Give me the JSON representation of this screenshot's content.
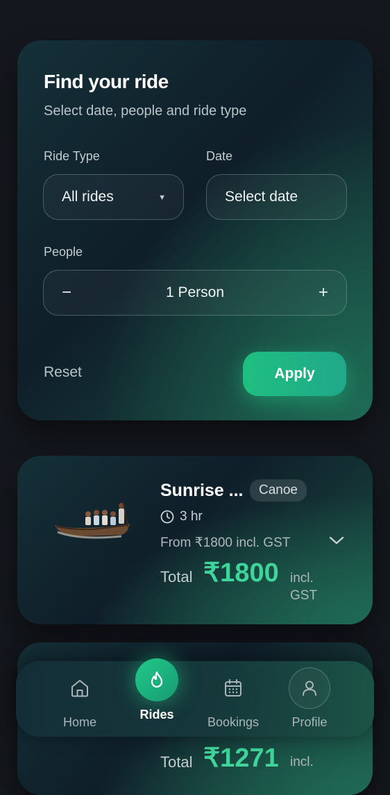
{
  "filter": {
    "title": "Find your ride",
    "subtitle": "Select date, people and ride type",
    "ride_type_label": "Ride Type",
    "ride_type_value": "All rides",
    "date_label": "Date",
    "date_placeholder": "Select date",
    "people_label": "People",
    "people_minus": "−",
    "people_value": "1 Person",
    "people_plus": "+",
    "reset_label": "Reset",
    "apply_label": "Apply"
  },
  "rides": [
    {
      "name": "Sunrise ...",
      "type_badge": "Canoe",
      "duration": "3 hr",
      "from_price": "From ₹1800 incl. GST",
      "total_label": "Total",
      "total_price": "₹1800",
      "tax_note": "incl. GST"
    },
    {
      "total_label": "Total",
      "total_price": "₹1271",
      "tax_note": "incl."
    }
  ],
  "nav": {
    "home": "Home",
    "rides": "Rides",
    "bookings": "Bookings",
    "profile": "Profile"
  },
  "colors": {
    "accent": "#2ecf90",
    "background": "#14171d"
  }
}
